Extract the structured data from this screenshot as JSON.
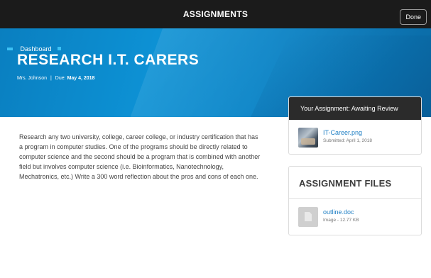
{
  "topbar": {
    "title": "ASSIGNMENTS",
    "done_label": "Done"
  },
  "breadcrumb": {
    "label": "Dashboard"
  },
  "assignment": {
    "title": "RESEARCH I.T. CARERS",
    "teacher": "Mrs. Johnson",
    "separator": "|",
    "due_label": "Due:",
    "due_date": "May 4, 2018",
    "description": "Research any two university, college, career college, or industry certification that has a program in computer studies. One of the programs should be directly related to computer science and the second should be a program that is combined with another field but involves computer science (i.e. Bioinformatics, Nanotechnology, Mechatronics, etc.) Write a 300 word reflection about the pros and cons of each one."
  },
  "submission": {
    "header": "Your Assignment: Awaiting Review",
    "file_name": "IT-Career.png",
    "submitted": "Submitted: April 1, 2018"
  },
  "assignment_files": {
    "title": "ASSIGNMENT FILES",
    "files": [
      {
        "name": "outline.doc",
        "meta": "Image - 12.77 KB"
      }
    ]
  },
  "colors": {
    "hero_blue": "#0d91d4",
    "link_blue": "#1f7fc4",
    "dark_bar": "#1b1b1b",
    "accent_cyan": "#3cc1f4"
  },
  "icons": [
    "image-thumbnail-icon",
    "document-icon"
  ]
}
